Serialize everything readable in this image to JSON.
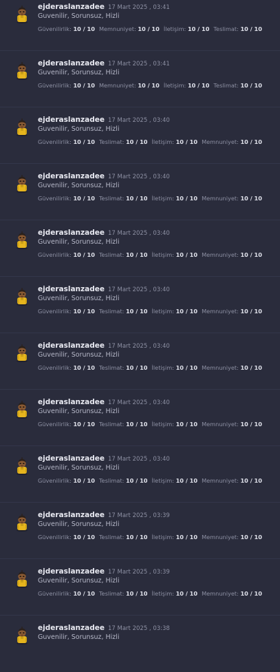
{
  "reviews": [
    {
      "user": "ejderaslanzadee",
      "date": "17 Mart 2025 , 03:41",
      "comment": "Guvenilir, Sorunsuz, Hizli",
      "ratings": [
        {
          "label": "Güvenilirlik:",
          "value": "10 / 10"
        },
        {
          "label": "Memnuniyet:",
          "value": "10 / 10"
        },
        {
          "label": "İletişim:",
          "value": "10 / 10"
        },
        {
          "label": "Teslimat:",
          "value": "10 / 10"
        }
      ]
    },
    {
      "user": "ejderaslanzadee",
      "date": "17 Mart 2025 , 03:41",
      "comment": "Guvenilir, Sorunsuz, Hizli",
      "ratings": [
        {
          "label": "Güvenilirlik:",
          "value": "10 / 10"
        },
        {
          "label": "Memnuniyet:",
          "value": "10 / 10"
        },
        {
          "label": "İletişim:",
          "value": "10 / 10"
        },
        {
          "label": "Teslimat:",
          "value": "10 / 10"
        }
      ]
    },
    {
      "user": "ejderaslanzadee",
      "date": "17 Mart 2025 , 03:40",
      "comment": "Guvenilir, Sorunsuz, Hizli",
      "ratings": [
        {
          "label": "Güvenilirlik:",
          "value": "10 / 10"
        },
        {
          "label": "Teslimat:",
          "value": "10 / 10"
        },
        {
          "label": "İletişim:",
          "value": "10 / 10"
        },
        {
          "label": "Memnuniyet:",
          "value": "10 / 10"
        }
      ]
    },
    {
      "user": "ejderaslanzadee",
      "date": "17 Mart 2025 , 03:40",
      "comment": "Guvenilir, Sorunsuz, Hizli",
      "ratings": [
        {
          "label": "Güvenilirlik:",
          "value": "10 / 10"
        },
        {
          "label": "Teslimat:",
          "value": "10 / 10"
        },
        {
          "label": "İletişim:",
          "value": "10 / 10"
        },
        {
          "label": "Memnuniyet:",
          "value": "10 / 10"
        }
      ]
    },
    {
      "user": "ejderaslanzadee",
      "date": "17 Mart 2025 , 03:40",
      "comment": "Guvenilir, Sorunsuz, Hizli",
      "ratings": [
        {
          "label": "Güvenilirlik:",
          "value": "10 / 10"
        },
        {
          "label": "Teslimat:",
          "value": "10 / 10"
        },
        {
          "label": "İletişim:",
          "value": "10 / 10"
        },
        {
          "label": "Memnuniyet:",
          "value": "10 / 10"
        }
      ]
    },
    {
      "user": "ejderaslanzadee",
      "date": "17 Mart 2025 , 03:40",
      "comment": "Guvenilir, Sorunsuz, Hizli",
      "ratings": [
        {
          "label": "Güvenilirlik:",
          "value": "10 / 10"
        },
        {
          "label": "Teslimat:",
          "value": "10 / 10"
        },
        {
          "label": "İletişim:",
          "value": "10 / 10"
        },
        {
          "label": "Memnuniyet:",
          "value": "10 / 10"
        }
      ]
    },
    {
      "user": "ejderaslanzadee",
      "date": "17 Mart 2025 , 03:40",
      "comment": "Guvenilir, Sorunsuz, Hizli",
      "ratings": [
        {
          "label": "Güvenilirlik:",
          "value": "10 / 10"
        },
        {
          "label": "Teslimat:",
          "value": "10 / 10"
        },
        {
          "label": "İletişim:",
          "value": "10 / 10"
        },
        {
          "label": "Memnuniyet:",
          "value": "10 / 10"
        }
      ]
    },
    {
      "user": "ejderaslanzadee",
      "date": "17 Mart 2025 , 03:40",
      "comment": "Guvenilir, Sorunsuz, Hizli",
      "ratings": [
        {
          "label": "Güvenilirlik:",
          "value": "10 / 10"
        },
        {
          "label": "Teslimat:",
          "value": "10 / 10"
        },
        {
          "label": "İletişim:",
          "value": "10 / 10"
        },
        {
          "label": "Memnuniyet:",
          "value": "10 / 10"
        }
      ]
    },
    {
      "user": "ejderaslanzadee",
      "date": "17 Mart 2025 , 03:40",
      "comment": "Guvenilir, Sorunsuz, Hizli",
      "ratings": [
        {
          "label": "Güvenilirlik:",
          "value": "10 / 10"
        },
        {
          "label": "Teslimat:",
          "value": "10 / 10"
        },
        {
          "label": "İletişim:",
          "value": "10 / 10"
        },
        {
          "label": "Memnuniyet:",
          "value": "10 / 10"
        }
      ]
    },
    {
      "user": "ejderaslanzadee",
      "date": "17 Mart 2025 , 03:39",
      "comment": "Guvenilir, Sorunsuz, Hizli",
      "ratings": [
        {
          "label": "Güvenilirlik:",
          "value": "10 / 10"
        },
        {
          "label": "Teslimat:",
          "value": "10 / 10"
        },
        {
          "label": "İletişim:",
          "value": "10 / 10"
        },
        {
          "label": "Memnuniyet:",
          "value": "10 / 10"
        }
      ]
    },
    {
      "user": "ejderaslanzadee",
      "date": "17 Mart 2025 , 03:39",
      "comment": "Guvenilir, Sorunsuz, Hizli",
      "ratings": [
        {
          "label": "Güvenilirlik:",
          "value": "10 / 10"
        },
        {
          "label": "Teslimat:",
          "value": "10 / 10"
        },
        {
          "label": "İletişim:",
          "value": "10 / 10"
        },
        {
          "label": "Memnuniyet:",
          "value": "10 / 10"
        }
      ]
    },
    {
      "user": "ejderaslanzadee",
      "date": "17 Mart 2025 , 03:38",
      "comment": "Guvenilir, Sorunsuz, Hizli",
      "ratings": []
    }
  ]
}
